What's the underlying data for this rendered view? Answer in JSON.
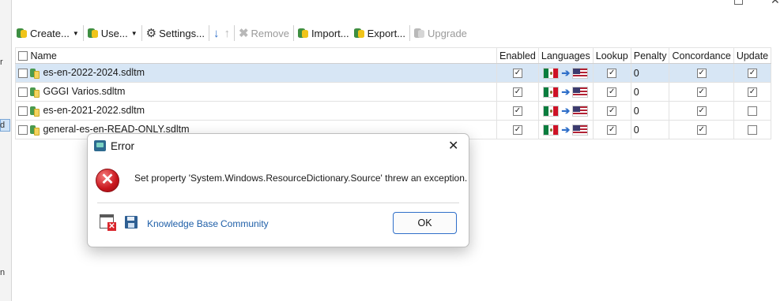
{
  "left_strip": {
    "fragment_1": "r",
    "fragment_2": "d",
    "fragment_3": "n"
  },
  "toolbar": {
    "create_label": "Create...",
    "use_label": "Use...",
    "settings_label": "Settings...",
    "remove_label": "Remove",
    "import_label": "Import...",
    "export_label": "Export...",
    "upgrade_label": "Upgrade"
  },
  "grid": {
    "columns": {
      "name": "Name",
      "enabled": "Enabled",
      "languages": "Languages",
      "lookup": "Lookup",
      "penalty": "Penalty",
      "concordance": "Concordance",
      "update": "Update"
    },
    "rows": [
      {
        "name": "es-en-2022-2024.sdltm",
        "enabled": true,
        "source_lang": "es-MX",
        "target_lang": "en-US",
        "lookup": true,
        "penalty": "0",
        "concordance": true,
        "update": true
      },
      {
        "name": "GGGI Varios.sdltm",
        "enabled": true,
        "source_lang": "es-MX",
        "target_lang": "en-US",
        "lookup": true,
        "penalty": "0",
        "concordance": true,
        "update": true
      },
      {
        "name": "es-en-2021-2022.sdltm",
        "enabled": true,
        "source_lang": "es-MX",
        "target_lang": "en-US",
        "lookup": true,
        "penalty": "0",
        "concordance": true,
        "update": false
      },
      {
        "name": "general-es-en-READ-ONLY.sdltm",
        "enabled": true,
        "source_lang": "es-MX",
        "target_lang": "en-US",
        "lookup": true,
        "penalty": "0",
        "concordance": true,
        "update": false
      }
    ],
    "selected_row": 0
  },
  "dialog": {
    "title": "Error",
    "message": "Set property 'System.Windows.ResourceDictionary.Source' threw an exception.",
    "link_knowledge_base": "Knowledge Base",
    "link_community": "Community",
    "ok_label": "OK"
  },
  "icons": {
    "error": "error-circle-icon",
    "dialog_app": "trados-app-icon",
    "window_error": "window-error-icon",
    "save": "save-icon"
  },
  "colors": {
    "accent": "#2f6fc9",
    "selected_row": "#d7e6f5",
    "error_red": "#c8161d",
    "link": "#1f5fa8"
  }
}
